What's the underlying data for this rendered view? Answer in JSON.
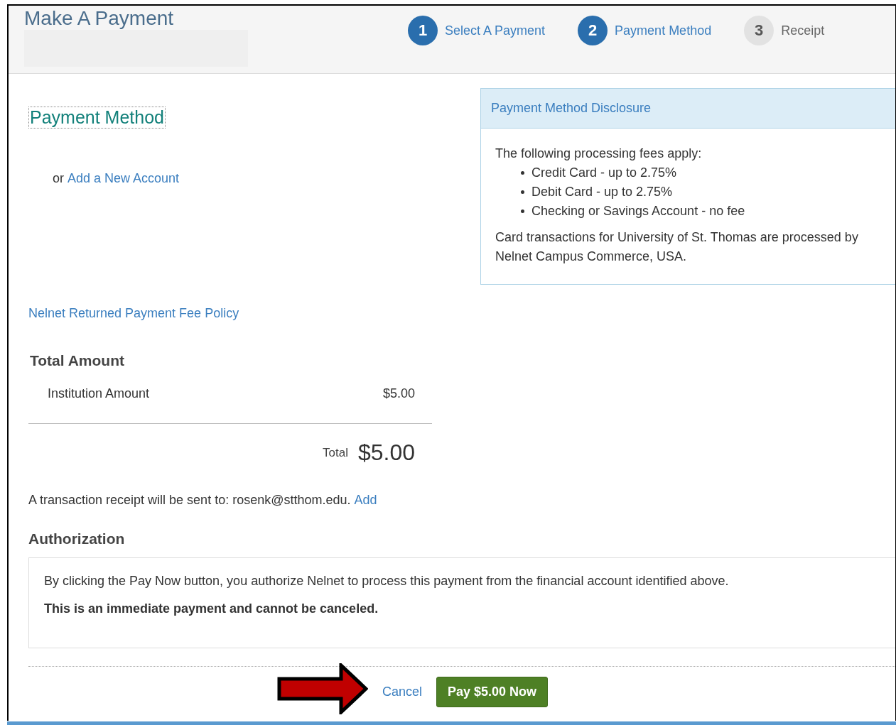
{
  "header": {
    "title": "Make A Payment",
    "steps": [
      {
        "number": "1",
        "label": "Select A Payment",
        "active": true
      },
      {
        "number": "2",
        "label": "Payment Method",
        "active": true
      },
      {
        "number": "3",
        "label": "Receipt",
        "active": false
      }
    ]
  },
  "payment_method": {
    "heading": "Payment Method",
    "or_text": "or",
    "add_link": "Add a New Account"
  },
  "disclosure": {
    "title": "Payment Method Disclosure",
    "intro": "The following processing fees apply:",
    "fees": [
      "Credit Card - up to 2.75%",
      "Debit Card - up to 2.75%",
      "Checking or Savings Account - no fee"
    ],
    "note": "Card transactions for University of St. Thomas are processed by Nelnet Campus Commerce, USA."
  },
  "policy_link": "Nelnet Returned Payment Fee Policy",
  "total": {
    "heading": "Total Amount",
    "items": [
      {
        "label": "Institution Amount",
        "amount": "$5.00"
      }
    ],
    "total_label": "Total",
    "total_value": "$5.00"
  },
  "receipt": {
    "text": "A transaction receipt will be sent to: rosenk@stthom.edu.",
    "link": "Add"
  },
  "authorization": {
    "heading": "Authorization",
    "text": "By clicking the Pay Now button, you authorize Nelnet to process this payment from the financial account identified above.",
    "warning": "This is an immediate payment and cannot be canceled."
  },
  "buttons": {
    "cancel": "Cancel",
    "pay": "Pay $5.00 Now"
  }
}
